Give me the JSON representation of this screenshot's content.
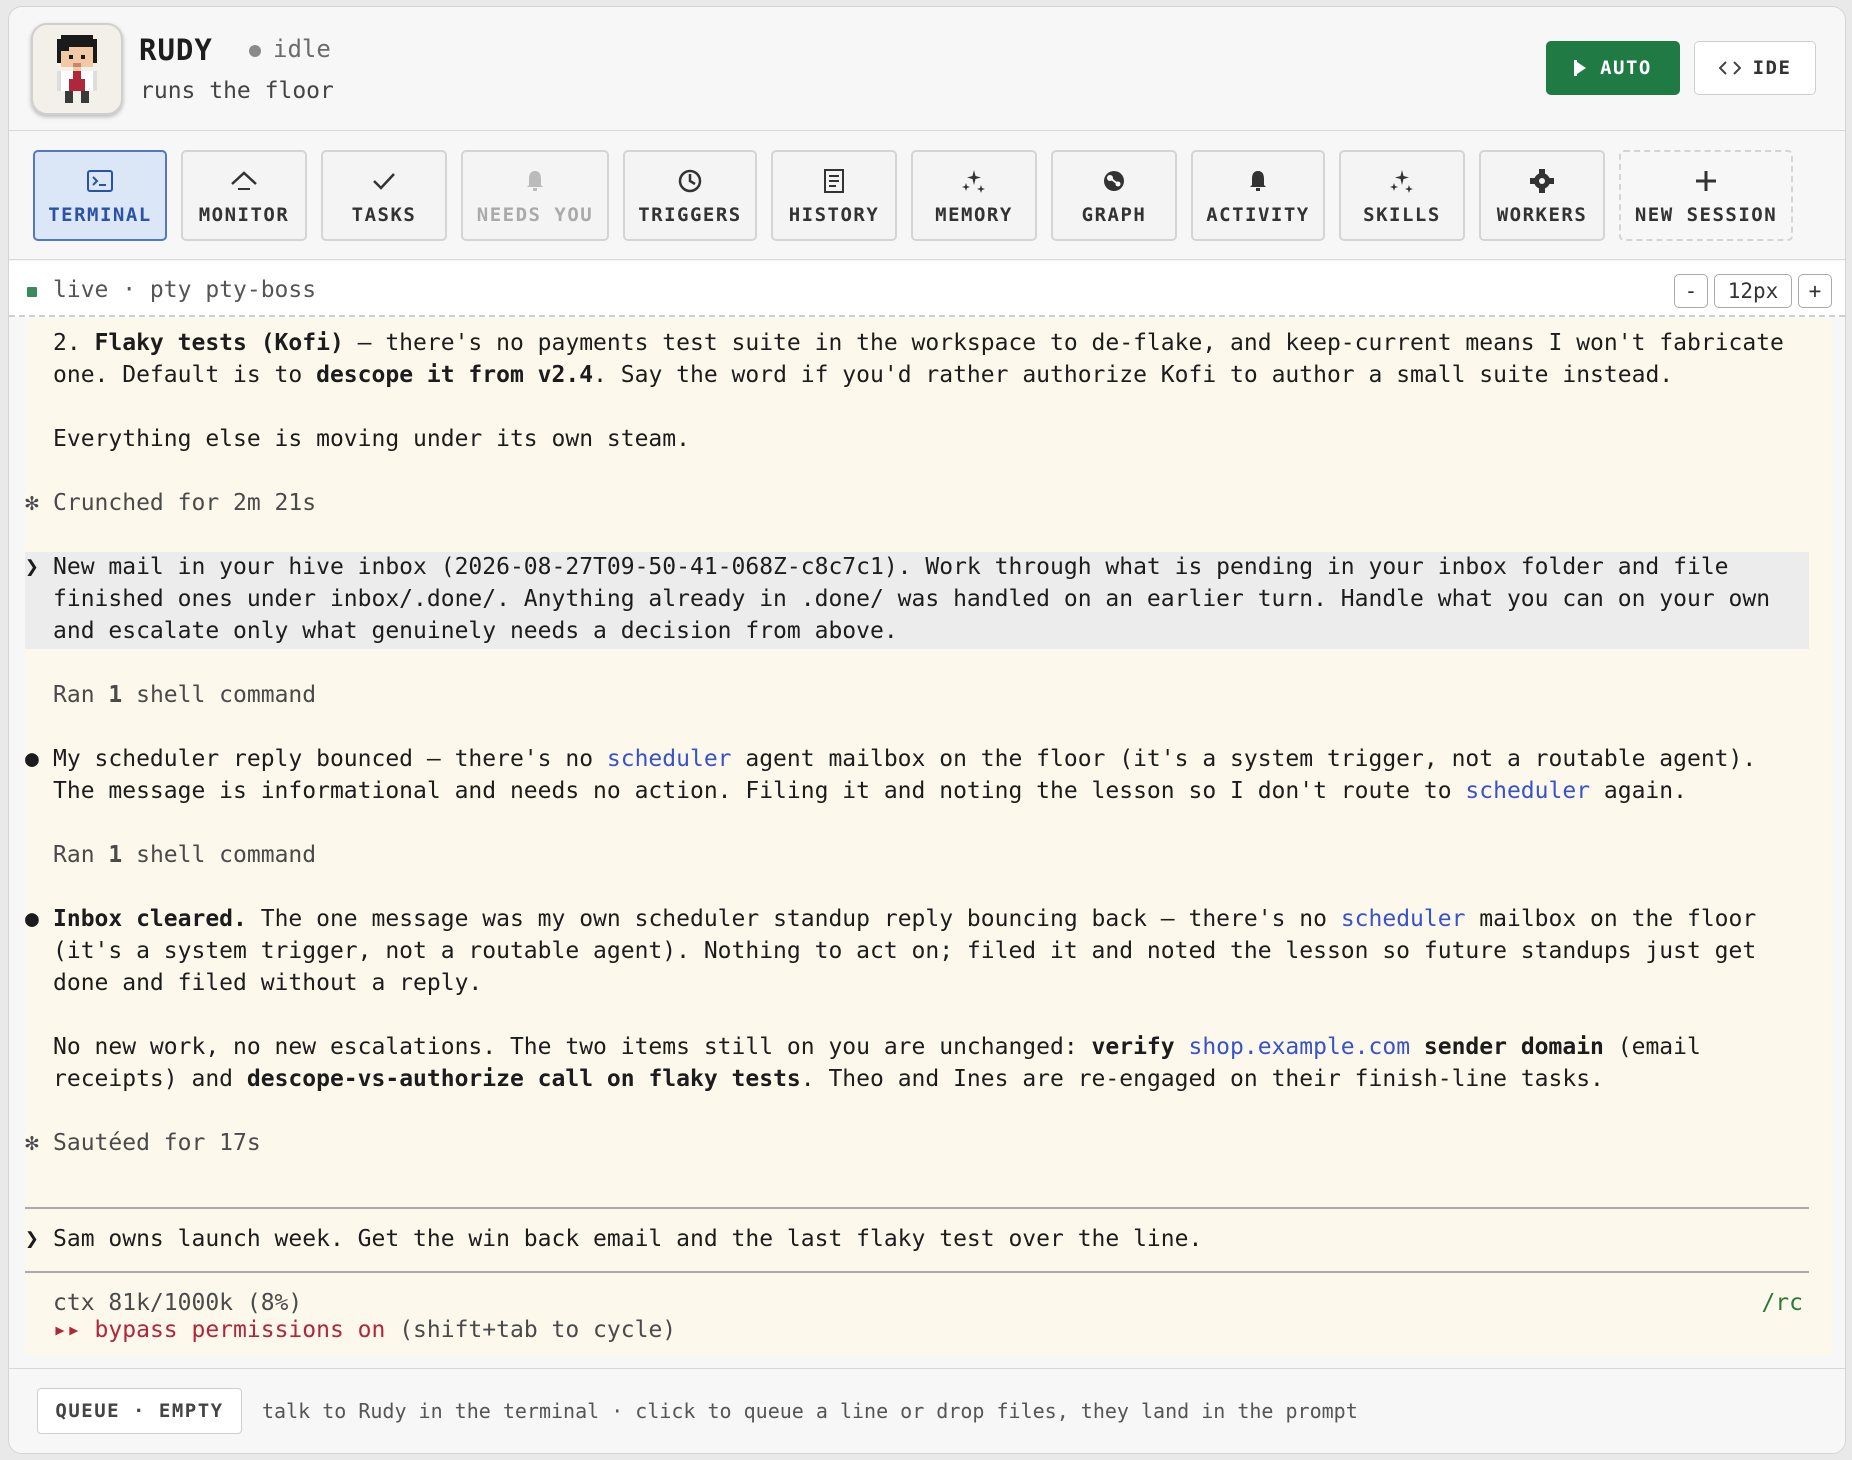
{
  "agent": {
    "name": "RUDY",
    "status": "idle",
    "role": "runs the floor"
  },
  "header_actions": {
    "auto_label": "AUTO",
    "ide_label": "IDE"
  },
  "tabs": [
    {
      "label": "TERMINAL",
      "icon": "terminal-icon",
      "active": true
    },
    {
      "label": "MONITOR",
      "icon": "monitor-icon"
    },
    {
      "label": "TASKS",
      "icon": "check-icon"
    },
    {
      "label": "NEEDS YOU",
      "icon": "bell-icon",
      "disabled": true
    },
    {
      "label": "TRIGGERS",
      "icon": "clock-icon"
    },
    {
      "label": "HISTORY",
      "icon": "document-icon"
    },
    {
      "label": "MEMORY",
      "icon": "sparkle-icon"
    },
    {
      "label": "GRAPH",
      "icon": "graph-icon"
    },
    {
      "label": "ACTIVITY",
      "icon": "bell-icon"
    },
    {
      "label": "SKILLS",
      "icon": "sparkle-icon"
    },
    {
      "label": "WORKERS",
      "icon": "gear-icon"
    },
    {
      "label": "NEW SESSION",
      "icon": "plus-icon"
    }
  ],
  "terminal": {
    "status": "live · pty pty-boss",
    "font_size": "12px",
    "decrease_label": "-",
    "increase_label": "+"
  },
  "transcript": {
    "item2": {
      "num": "2. ",
      "title": "Flaky tests (Kofi)",
      "t1": " — there's no payments test suite in the workspace to de-flake, and keep-current means I won't fabricate",
      "t2a": "one. Default is to ",
      "t2b": "descope it from v2.4",
      "t2c": ". Say the word if you'd rather authorize Kofi to author a small suite instead."
    },
    "steam": "Everything else is moving under its own steam.",
    "crunched_mark": "✻",
    "crunched": "Crunched for 2m 21s",
    "prompt_mark": "❯",
    "prompt1": [
      "New mail in your hive inbox (2026-08-27T09-50-41-068Z-c8c7c1). Work through what is pending in your inbox folder and file",
      "finished ones under inbox/.done/. Anything already in .done/ was handled on an earlier turn. Handle what you can on your own",
      "and escalate only what genuinely needs a decision from above."
    ],
    "ran_a": "Ran ",
    "ran_n": "1",
    "ran_b": " shell command",
    "bullet": "●",
    "msg1": {
      "a": "My scheduler reply bounced — there's no ",
      "link": "scheduler",
      "b": " agent mailbox on the floor (it's a system trigger, not a routable agent).",
      "c": "The message is informational and needs no action. Filing it and noting the lesson so I don't route to ",
      "d": " again."
    },
    "msg2": {
      "bold": "Inbox cleared.",
      "a": " The one message was my own scheduler standup reply bouncing back — there's no ",
      "link": "scheduler",
      "b": " mailbox on the floor",
      "l2": "(it's a system trigger, not a routable agent). Nothing to act on; filed it and noted the lesson so future standups just get",
      "l3": "done and filed without a reply."
    },
    "msg3": {
      "a": "No new work, no new escalations. The two items still on you are unchanged: ",
      "b1": "verify ",
      "link": "shop.example.com",
      "b2": " sender domain",
      "c": " (email",
      "d": "receipts) and ",
      "b3": "descope-vs-authorize call on flaky tests",
      "e": ". Theo and Ines are re-engaged on their finish-line tasks."
    },
    "sauteed": "Sautéed for 17s",
    "prompt2": "Sam owns launch week. Get the win back email and the last flaky test over the line.",
    "ctx": "ctx 81k/1000k (8%)",
    "rc": "/rc",
    "bypass_mark": "▸▸",
    "bypass": " bypass permissions on",
    "bypass_hint": " (shift+tab to cycle)"
  },
  "footer": {
    "queue_label": "QUEUE · EMPTY",
    "hint": "talk to Rudy in the terminal · click to queue a line or drop files, they land in the prompt"
  },
  "colors": {
    "accent_green": "#1f7a44",
    "active_tab": "#5477c8",
    "link": "#3a52c9",
    "warning_red": "#b0263a",
    "terminal_bg": "#fcf8ec"
  }
}
